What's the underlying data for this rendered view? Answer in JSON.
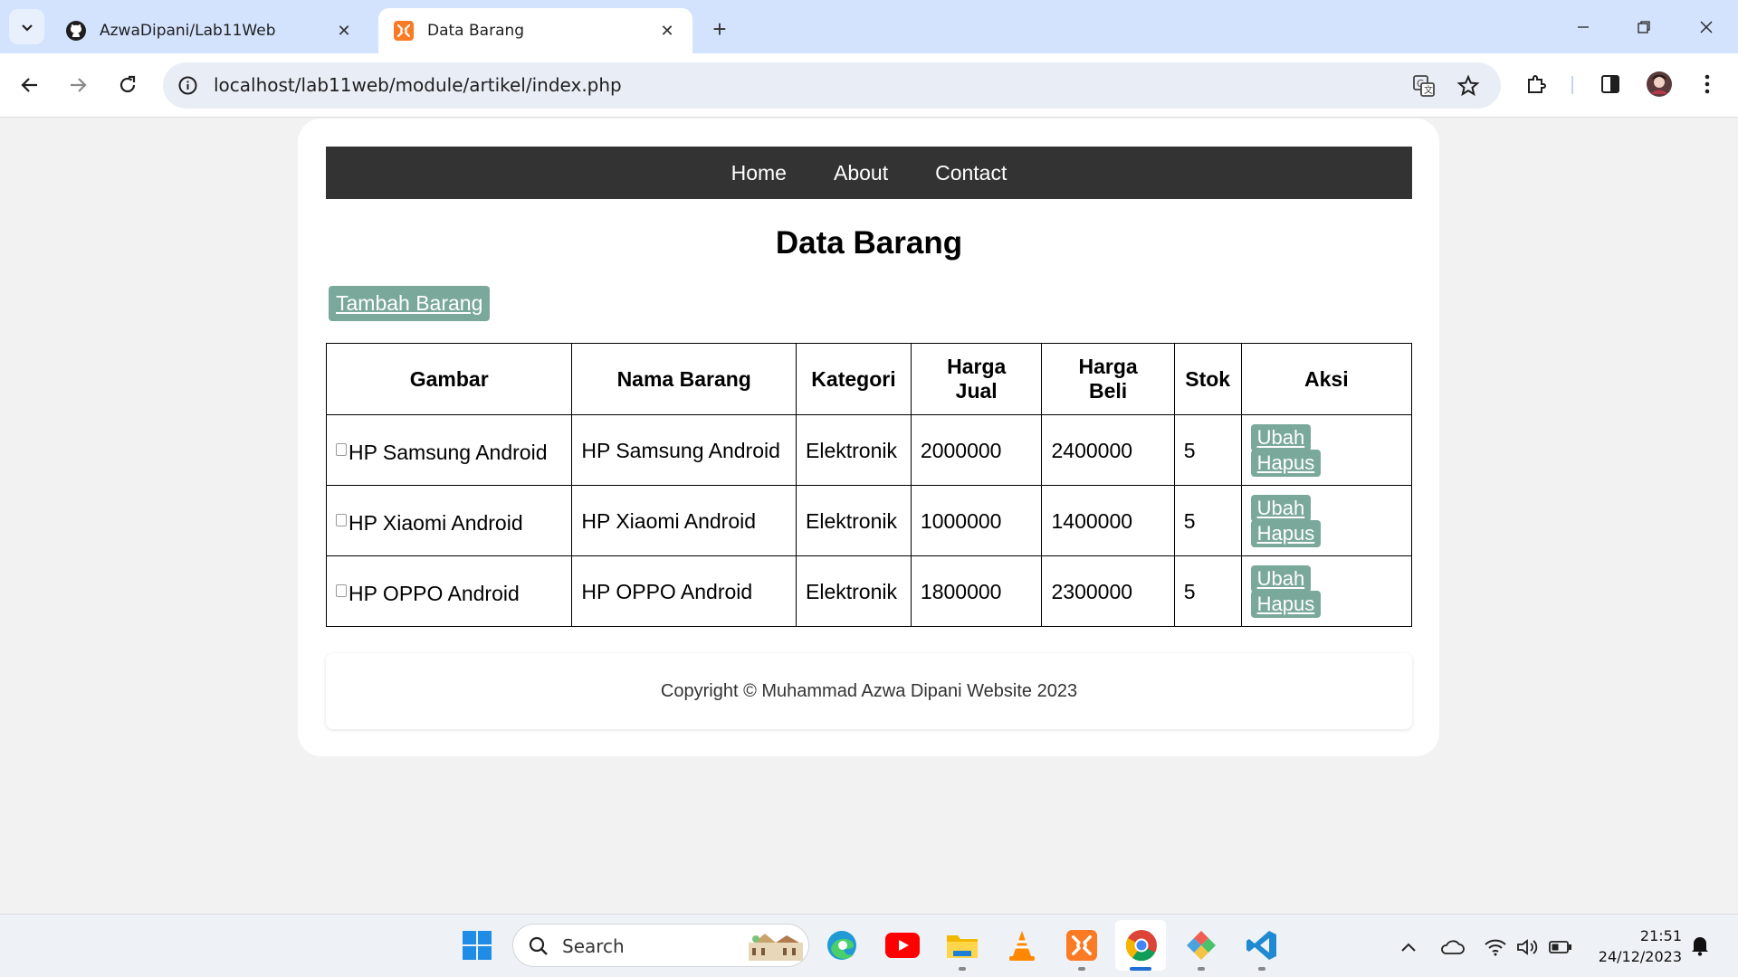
{
  "browser": {
    "tabs": [
      {
        "title": "AzwaDipani/Lab11Web",
        "icon": "github-icon",
        "active": false
      },
      {
        "title": "Data Barang",
        "icon": "xampp-icon",
        "active": true
      }
    ],
    "url": "localhost/lab11web/module/artikel/index.php"
  },
  "page": {
    "nav": [
      "Home",
      "About",
      "Contact"
    ],
    "title": "Data Barang",
    "add_button": "Tambah Barang",
    "table": {
      "headers": [
        "Gambar",
        "Nama Barang",
        "Kategori",
        "Harga Jual",
        "Harga Beli",
        "Stok",
        "Aksi"
      ],
      "rows": [
        {
          "gambar_alt": "HP Samsung Android",
          "nama": "HP Samsung Android",
          "kategori": "Elektronik",
          "harga_jual": "2000000",
          "harga_beli": "2400000",
          "stok": "5"
        },
        {
          "gambar_alt": "HP Xiaomi Android",
          "nama": "HP Xiaomi Android",
          "kategori": "Elektronik",
          "harga_jual": "1000000",
          "harga_beli": "1400000",
          "stok": "5"
        },
        {
          "gambar_alt": "HP OPPO Android",
          "nama": "HP OPPO Android",
          "kategori": "Elektronik",
          "harga_jual": "1800000",
          "harga_beli": "2300000",
          "stok": "5"
        }
      ],
      "action_edit": "Ubah",
      "action_delete": "Hapus"
    },
    "footer": "Copyright © Muhammad Azwa Dipani Website 2023"
  },
  "taskbar": {
    "search_placeholder": "Search",
    "clock_time": "21:51",
    "clock_date": "24/12/2023"
  },
  "colors": {
    "nav_bg": "#333333",
    "button_bg": "#7aa89a",
    "tabbar_bg": "#d3e3fd"
  }
}
